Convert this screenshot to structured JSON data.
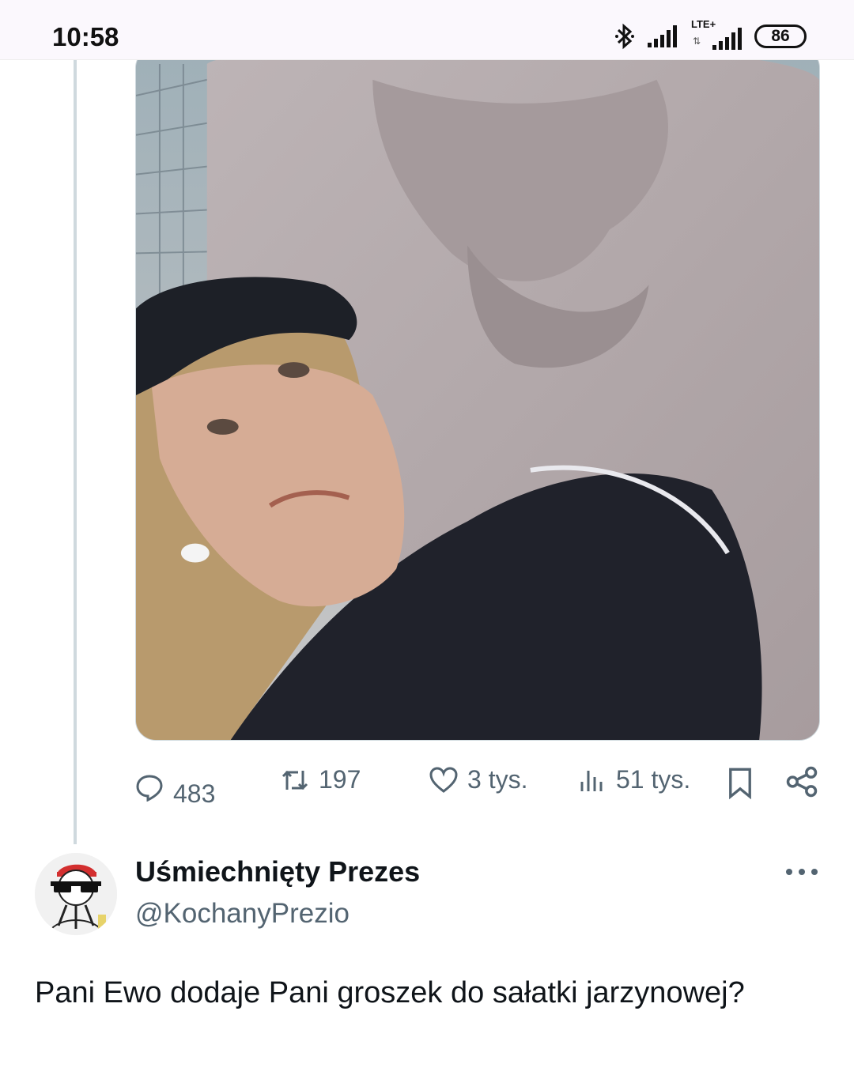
{
  "status_bar": {
    "time": "10:58",
    "network": "LTE+",
    "battery": "86",
    "icons": [
      "bluetooth-icon",
      "signal-icon",
      "lte-signal-icon",
      "battery-icon"
    ]
  },
  "tweet": {
    "media": {
      "description_icon": "photo"
    },
    "actions": {
      "replies": "483",
      "retweets": "197",
      "likes": "3 tys.",
      "views": "51 tys."
    }
  },
  "reply": {
    "display_name": "Uśmiechnięty Prezes",
    "handle": "@KochanyPrezio",
    "text": "Pani Ewo dodaje Pani groszek do sałatki jarzynowej?"
  },
  "colors": {
    "text_primary": "#0f1419",
    "text_secondary": "#536471",
    "thread_line": "#cfd9de",
    "status_bar_bg": "#fbf8fd"
  }
}
